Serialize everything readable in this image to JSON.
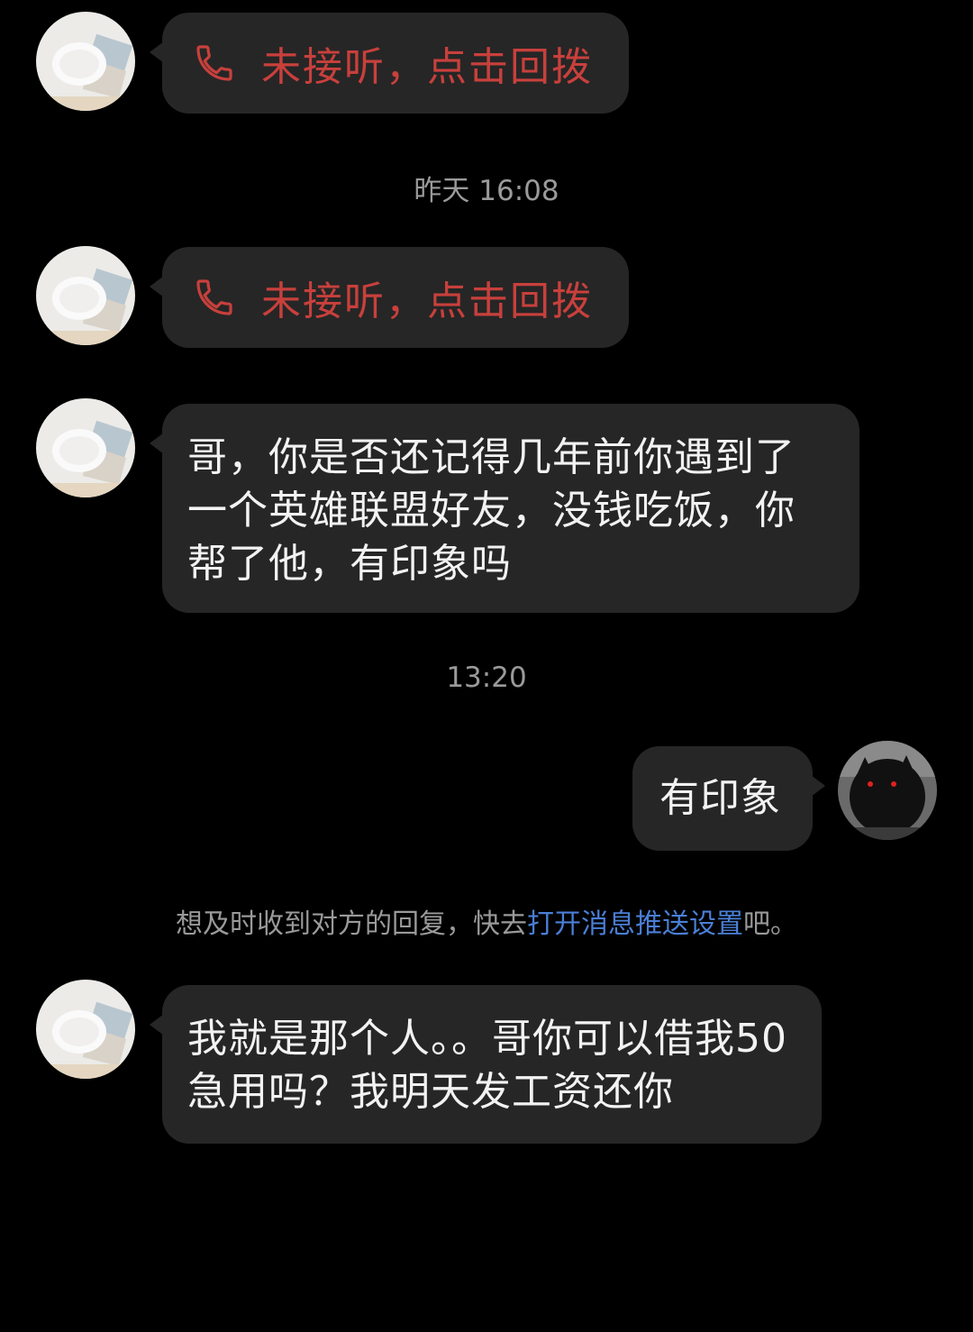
{
  "chat": {
    "messages": [
      {
        "type": "missed_call",
        "text": "未接听，点击回拨"
      },
      {
        "type": "time",
        "text": "昨天 16:08"
      },
      {
        "type": "missed_call",
        "text": "未接听，点击回拨"
      },
      {
        "type": "text",
        "text": "哥，你是否还记得几年前你遇到了一个英雄联盟好友，没钱吃饭，你帮了他，有印象吗"
      },
      {
        "type": "time",
        "text": "13:20"
      },
      {
        "type": "text_self",
        "text": "有印象"
      },
      {
        "type": "notice",
        "prefix": "想及时收到对方的回复，快去",
        "link": "打开消息推送设置",
        "suffix": "吧。"
      },
      {
        "type": "text",
        "text": "我就是那个人。。哥你可以借我50急用吗？我明天发工资还你"
      }
    ]
  },
  "colors": {
    "background": "#000000",
    "bubble": "#262626",
    "missed_call": "#c8403c",
    "link": "#4a7fd6",
    "meta_text": "#9a9a9a"
  },
  "icons": {
    "call": "phone-icon",
    "contact_avatar": "avatar-contact",
    "self_avatar": "avatar-self"
  }
}
